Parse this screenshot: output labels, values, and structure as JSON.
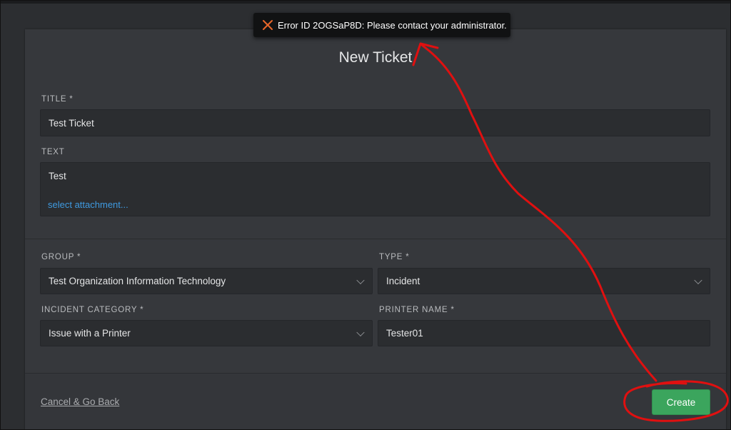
{
  "toast": {
    "icon": "close-icon",
    "message": "Error ID 2OGSaP8D: Please contact your administrator."
  },
  "form": {
    "title": "New Ticket",
    "fields": {
      "title": {
        "label": "TITLE *",
        "value": "Test Ticket"
      },
      "text": {
        "label": "TEXT",
        "value": "Test",
        "attachment_link": "select attachment..."
      },
      "group": {
        "label": "GROUP *",
        "value": "Test Organization Information Technology"
      },
      "type": {
        "label": "TYPE *",
        "value": "Incident"
      },
      "incident_category": {
        "label": "INCIDENT CATEGORY *",
        "value": "Issue with a Printer"
      },
      "printer_name": {
        "label": "PRINTER NAME *",
        "value": "Tester01"
      }
    }
  },
  "footer": {
    "cancel_label": "Cancel & Go Back",
    "create_label": "Create"
  },
  "colors": {
    "accent_green": "#3ba55d",
    "link_blue": "#3f9ae0",
    "toast_icon": "#e8662a",
    "annotation_red": "#e01010"
  }
}
